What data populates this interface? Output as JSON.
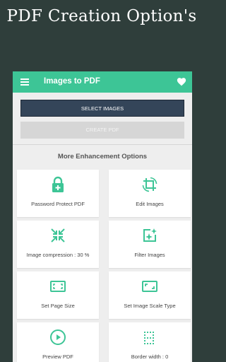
{
  "promo": {
    "title": "PDF Creation Option's"
  },
  "appbar": {
    "title": "Images to PDF",
    "menu_icon": "hamburger-menu-icon",
    "favorite_icon": "heart-icon"
  },
  "actions": {
    "select_images": "SELECT IMAGES",
    "create_pdf": "CREATE PDF"
  },
  "enhancements": {
    "title": "More Enhancement Options",
    "items": [
      {
        "label": "Password Protect PDF",
        "icon": "lock-plus-icon"
      },
      {
        "label": "Edit Images",
        "icon": "crop-rotate-icon"
      },
      {
        "label": "Image compression : 30 %",
        "icon": "compress-arrows-icon"
      },
      {
        "label": "Filter Images",
        "icon": "image-filter-icon"
      },
      {
        "label": "Set Page Size",
        "icon": "page-size-icon"
      },
      {
        "label": "Set Image Scale Type",
        "icon": "image-scale-icon"
      },
      {
        "label": "Preview PDF",
        "icon": "play-circle-icon"
      },
      {
        "label": "Border width : 0",
        "icon": "border-style-icon"
      }
    ]
  },
  "colors": {
    "accent": "#3dc596",
    "primary_button": "#344559",
    "disabled_button": "#d6d6d6",
    "background": "#2f3e3b"
  }
}
